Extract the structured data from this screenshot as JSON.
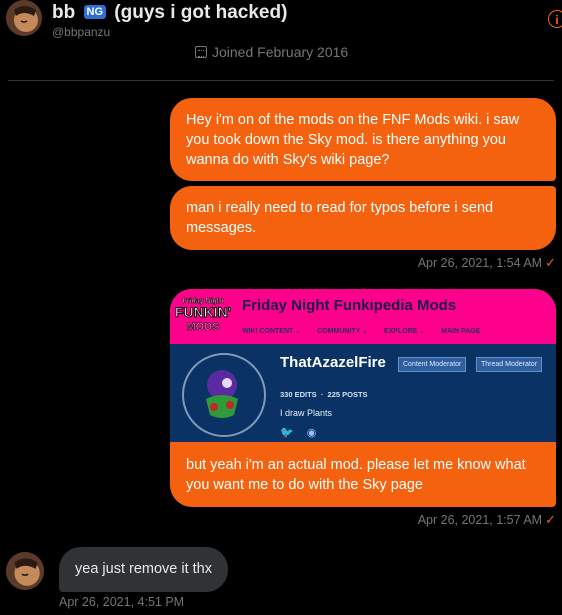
{
  "header": {
    "name": "bb",
    "badge": "NG",
    "name_suffix": "(guys i got hacked)",
    "handle": "@bbpanzu",
    "joined": "Joined February 2016"
  },
  "colors": {
    "accent": "#f4620f",
    "received_bubble": "#2f3336",
    "background": "#000000"
  },
  "messages": [
    {
      "text": "Hey i'm on of the mods on the FNF Mods wiki. i saw you took down the Sky mod. is there anything you wanna do with Sky's wiki page?"
    },
    {
      "text": "man i really need to read for typos before i send messages."
    }
  ],
  "timestamp1": "Apr 26, 2021, 1:54 AM",
  "wiki_card": {
    "logo_line1": "Friday Night",
    "logo_line2": "FUNKIN'",
    "logo_line3": "MODS",
    "title": "Friday Night Funkipedia Mods",
    "nav": [
      "WIKI CONTENT ⌄",
      "COMMUNITY ⌄",
      "EXPLORE ⌄",
      "MAIN PAGE"
    ],
    "username": "ThatAzazelFire",
    "tags": [
      "Content Moderator",
      "Thread Moderator"
    ],
    "edits": "330 EDITS",
    "posts": "225 POSTS",
    "bio": "I draw Plants",
    "message": "but yeah i'm an actual mod. please let me know what you want me to do with the Sky page"
  },
  "timestamp2": "Apr 26, 2021, 1:57 AM",
  "reply": {
    "text": "yea just remove it thx",
    "timestamp": "Apr 26, 2021, 4:51 PM"
  }
}
